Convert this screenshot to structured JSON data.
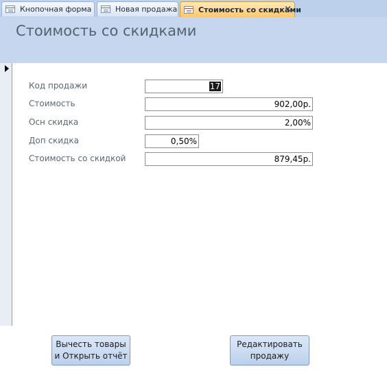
{
  "tabs": [
    {
      "label": "Кнопочная форма",
      "active": false
    },
    {
      "label": "Новая продажа",
      "active": false
    },
    {
      "label": "Стоимость со скидками",
      "active": true
    }
  ],
  "tab_close_glyph": "×",
  "form": {
    "title": "Стоимость со скидками",
    "fields": [
      {
        "label": "Код продажи",
        "value": "17"
      },
      {
        "label": "Стоимость",
        "value": "902,00р."
      },
      {
        "label": "Осн скидка",
        "value": "2,00%"
      },
      {
        "label": "Доп скидка",
        "value": "0,50%"
      },
      {
        "label": "Стоимость со скидкой",
        "value": "879,45р."
      }
    ]
  },
  "buttons": {
    "deduct_open_report": "Вычесть товары\nи Открыть отчёт",
    "edit_sale": "Редактировать\nпродажу"
  },
  "icons": {
    "tab_icon": "form-icon",
    "record_selector": "current-record-arrow-icon"
  },
  "colors": {
    "header_bg": "#c5d6ee",
    "active_tab": "#ffc66a",
    "title_text": "#556170"
  }
}
